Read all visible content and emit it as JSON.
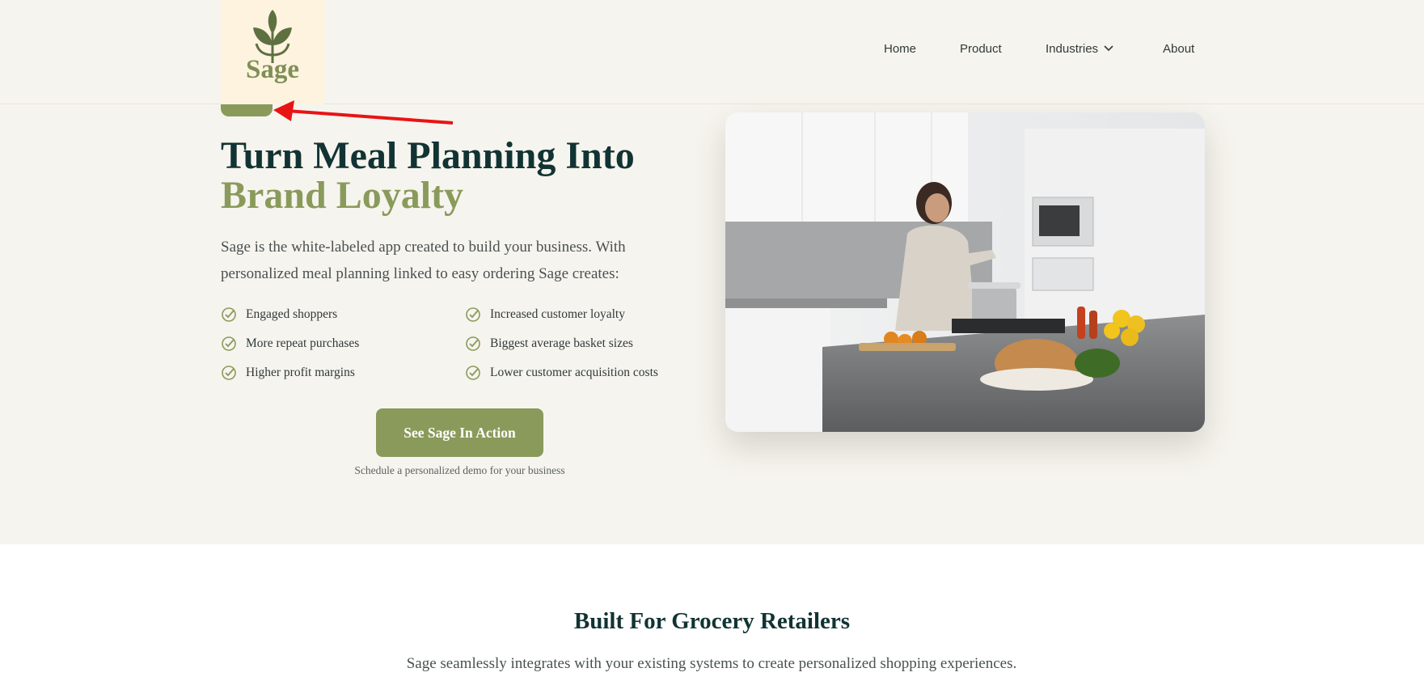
{
  "brand": {
    "name": "Sage",
    "accent": "#8a9a5b",
    "dark": "#123333",
    "bg": "#f6f4ee"
  },
  "nav": {
    "home": "Home",
    "product": "Product",
    "industries": "Industries",
    "about": "About"
  },
  "hero": {
    "headline_line1": "Turn Meal Planning Into",
    "headline_line2": "Brand Loyalty",
    "description": "Sage is the white-labeled app created to build your business. With personalized meal planning linked to easy ordering Sage creates:",
    "benefits": [
      "Engaged shoppers",
      "Increased customer loyalty",
      "More repeat purchases",
      "Biggest average basket sizes",
      "Higher profit margins",
      "Lower customer acquisition costs"
    ],
    "cta_label": "See Sage In Action",
    "cta_subtext": "Schedule a personalized demo for your business"
  },
  "section2": {
    "title": "Built For Grocery Retailers",
    "description": "Sage seamlessly integrates with your existing systems to create personalized shopping experiences."
  },
  "icons": [
    "leaf-logo-icon",
    "chevron-down-icon",
    "check-circle-icon"
  ]
}
